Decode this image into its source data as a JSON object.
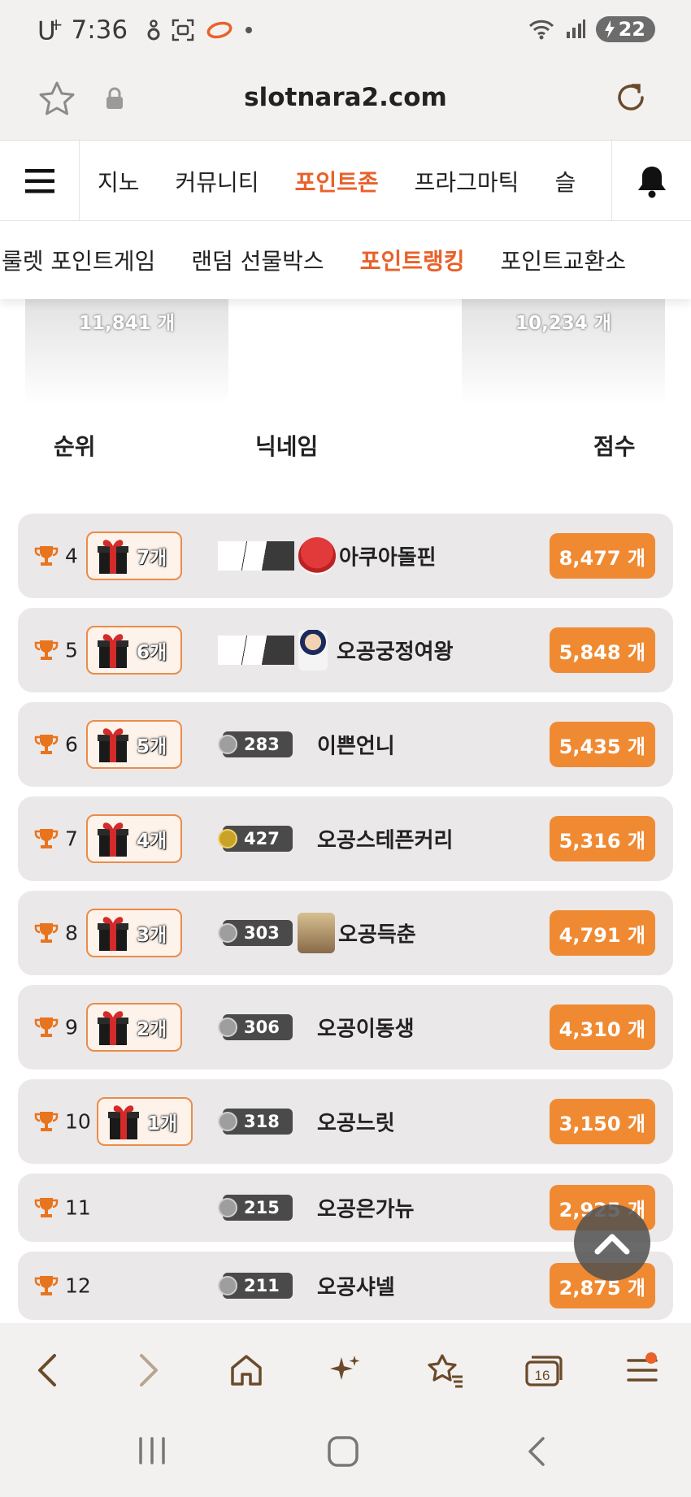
{
  "status_bar": {
    "carrier": "U",
    "carrier_sup": "+",
    "time": "7:36",
    "battery": "22"
  },
  "address_bar": {
    "url": "slotnara2.com"
  },
  "main_nav": {
    "items": [
      "지노",
      "커뮤니티",
      "포인트존",
      "프라그마틱",
      "슬"
    ],
    "active_index": 2
  },
  "sub_nav": {
    "items": [
      "룰렛 포인트게임",
      "랜덤 선물박스",
      "포인트랭킹",
      "포인트교환소"
    ],
    "active_index": 2
  },
  "podium": {
    "left_value": "11,841 개",
    "right_value": "10,234 개"
  },
  "table_header": {
    "rank": "순위",
    "nickname": "닉네임",
    "score": "점수"
  },
  "rows": [
    {
      "rank": "4",
      "gift": "7개",
      "level": "",
      "nickname": "아쿠아돌핀",
      "score": "8,477 개"
    },
    {
      "rank": "5",
      "gift": "6개",
      "level": "",
      "nickname": "오공궁정여왕",
      "score": "5,848 개"
    },
    {
      "rank": "6",
      "gift": "5개",
      "level": "283",
      "nickname": "이쁜언니",
      "score": "5,435 개"
    },
    {
      "rank": "7",
      "gift": "4개",
      "level": "427",
      "nickname": "오공스테픈커리",
      "score": "5,316 개"
    },
    {
      "rank": "8",
      "gift": "3개",
      "level": "303",
      "nickname": "오공득춘",
      "score": "4,791 개"
    },
    {
      "rank": "9",
      "gift": "2개",
      "level": "306",
      "nickname": "오공이동생",
      "score": "4,310 개"
    },
    {
      "rank": "10",
      "gift": "1개",
      "level": "318",
      "nickname": "오공느릿",
      "score": "3,150 개"
    },
    {
      "rank": "11",
      "gift": "",
      "level": "215",
      "nickname": "오공은가뉴",
      "score": "2,925 개"
    },
    {
      "rank": "12",
      "gift": "",
      "level": "211",
      "nickname": "오공샤넬",
      "score": "2,875 개"
    }
  ],
  "toolbar": {
    "tabs_count": "16"
  },
  "colors": {
    "accent": "#e8622a",
    "score_badge": "#f08a32",
    "row_bg": "#ebe8ea"
  }
}
